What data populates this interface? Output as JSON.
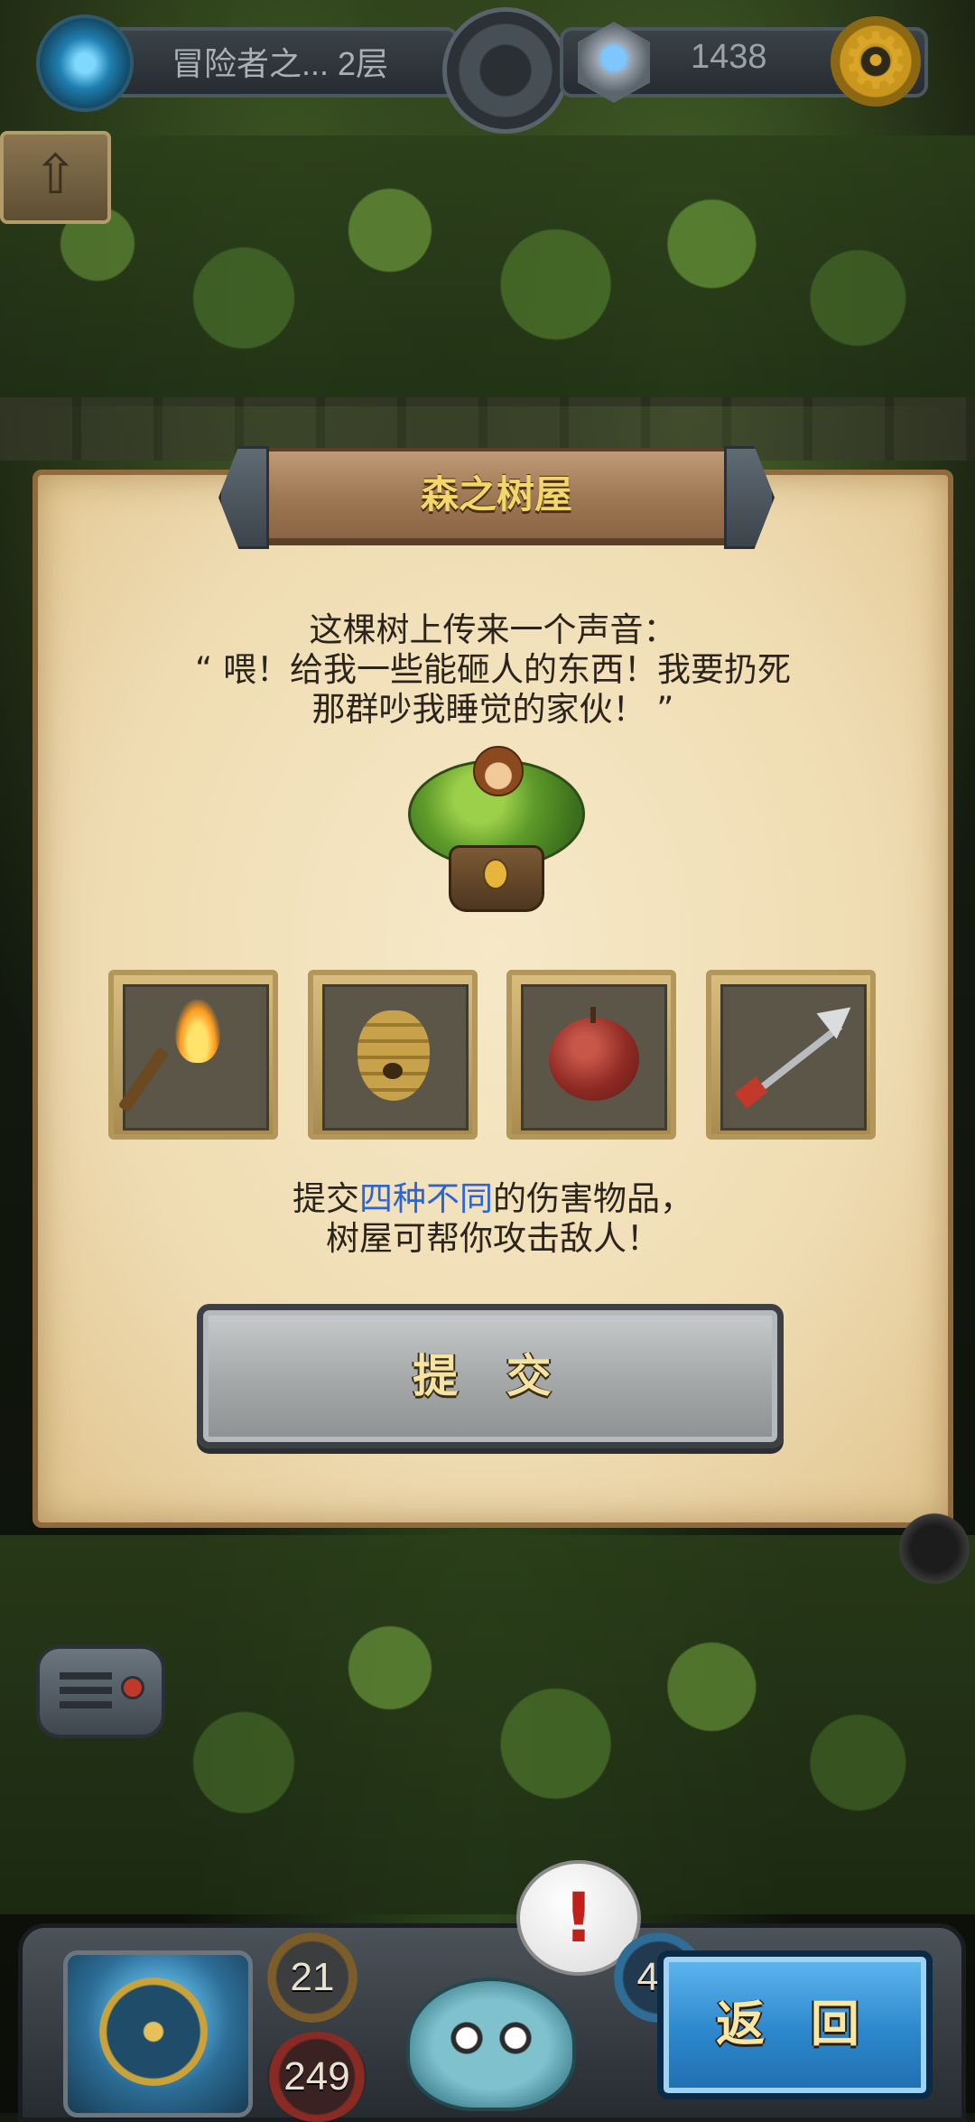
{
  "hud": {
    "floor_label": "冒险者之... 2层",
    "gold": "1438"
  },
  "dialog": {
    "title": "森之树屋",
    "story_lines": [
      "这棵树上传来一个声音：",
      "“ 喂！给我一些能砸人的东西！我要扔死",
      "那群吵我睡觉的家伙！ ”"
    ],
    "items": [
      {
        "name": "torch"
      },
      {
        "name": "beehive"
      },
      {
        "name": "apple"
      },
      {
        "name": "arrow"
      }
    ],
    "hint_prefix": "提交",
    "hint_highlight": "四种不同",
    "hint_suffix": "的伤害物品，",
    "hint_line2": "树屋可帮你攻击敌人！",
    "submit_label": "提 交",
    "highlight_color": "#2b63d9"
  },
  "player": {
    "attack": "21",
    "hp": "249",
    "defense": "44",
    "alert_symbol": "!"
  },
  "back_label": "返 回"
}
